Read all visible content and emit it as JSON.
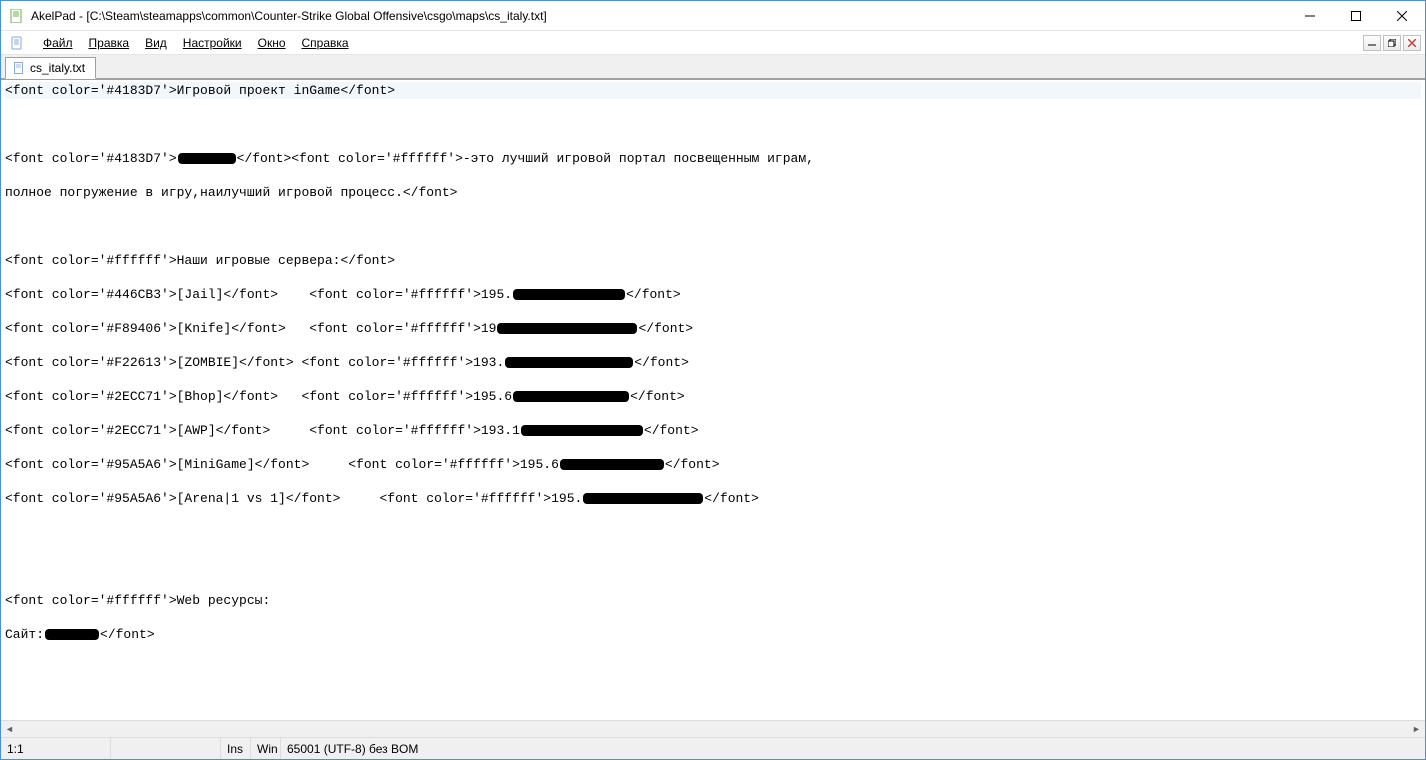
{
  "titlebar": {
    "title": "AkelPad - [C:\\Steam\\steamapps\\common\\Counter-Strike Global Offensive\\csgo\\maps\\cs_italy.txt]"
  },
  "menu": {
    "file": "Файл",
    "edit": "Правка",
    "view": "Вид",
    "settings": "Настройки",
    "window": "Окно",
    "help": "Справка"
  },
  "tab": {
    "label": "cs_italy.txt"
  },
  "editor": {
    "lines": [
      {
        "seg": [
          {
            "t": "<font color='#4183D7'>Игровой проект inGame</font>"
          }
        ],
        "hl": true
      },
      {
        "seg": []
      },
      {
        "seg": [
          {
            "t": "<font color='#4183D7'>"
          },
          {
            "r": 58
          },
          {
            "t": "</font><font color='#ffffff'>-это лучший игровой портал посвещенным играм,"
          }
        ]
      },
      {
        "seg": [
          {
            "t": "полное погружение в игру,наилучший игровой процесс.</font>"
          }
        ]
      },
      {
        "seg": []
      },
      {
        "seg": [
          {
            "t": "<font color='#ffffff'>Наши игровые сервера:</font>"
          }
        ]
      },
      {
        "seg": [
          {
            "t": "<font color='#446CB3'>[Jail]</font>    <font color='#ffffff'>195."
          },
          {
            "r": 112
          },
          {
            "t": "</font>"
          }
        ]
      },
      {
        "seg": [
          {
            "t": "<font color='#F89406'>[Knife]</font>   <font color='#ffffff'>19"
          },
          {
            "r": 140
          },
          {
            "t": "</font>"
          }
        ]
      },
      {
        "seg": [
          {
            "t": "<font color='#F22613'>[ZOMBIE]</font> <font color='#ffffff'>193."
          },
          {
            "r": 128
          },
          {
            "t": "</font>"
          }
        ]
      },
      {
        "seg": [
          {
            "t": "<font color='#2ECC71'>[Bhop]</font>   <font color='#ffffff'>195.6"
          },
          {
            "r": 116
          },
          {
            "t": "</font>"
          }
        ]
      },
      {
        "seg": [
          {
            "t": "<font color='#2ECC71'>[AWP]</font>     <font color='#ffffff'>193.1"
          },
          {
            "r": 122
          },
          {
            "t": "</font>"
          }
        ]
      },
      {
        "seg": [
          {
            "t": "<font color='#95A5A6'>[MiniGame]</font>     <font color='#ffffff'>195.6"
          },
          {
            "r": 104
          },
          {
            "t": "</font>"
          }
        ]
      },
      {
        "seg": [
          {
            "t": "<font color='#95A5A6'>[Arena|1 vs 1]</font>     <font color='#ffffff'>195."
          },
          {
            "r": 120
          },
          {
            "t": "</font>"
          }
        ]
      },
      {
        "seg": []
      },
      {
        "seg": []
      },
      {
        "seg": [
          {
            "t": "<font color='#ffffff'>Web ресурсы:"
          }
        ]
      },
      {
        "seg": [
          {
            "t": "Сайт:"
          },
          {
            "r": 54
          },
          {
            "t": "</font>"
          }
        ]
      }
    ]
  },
  "status": {
    "pos": "1:1",
    "ins": "Ins",
    "eol": "Win",
    "enc": "65001 (UTF-8) без BOM"
  }
}
